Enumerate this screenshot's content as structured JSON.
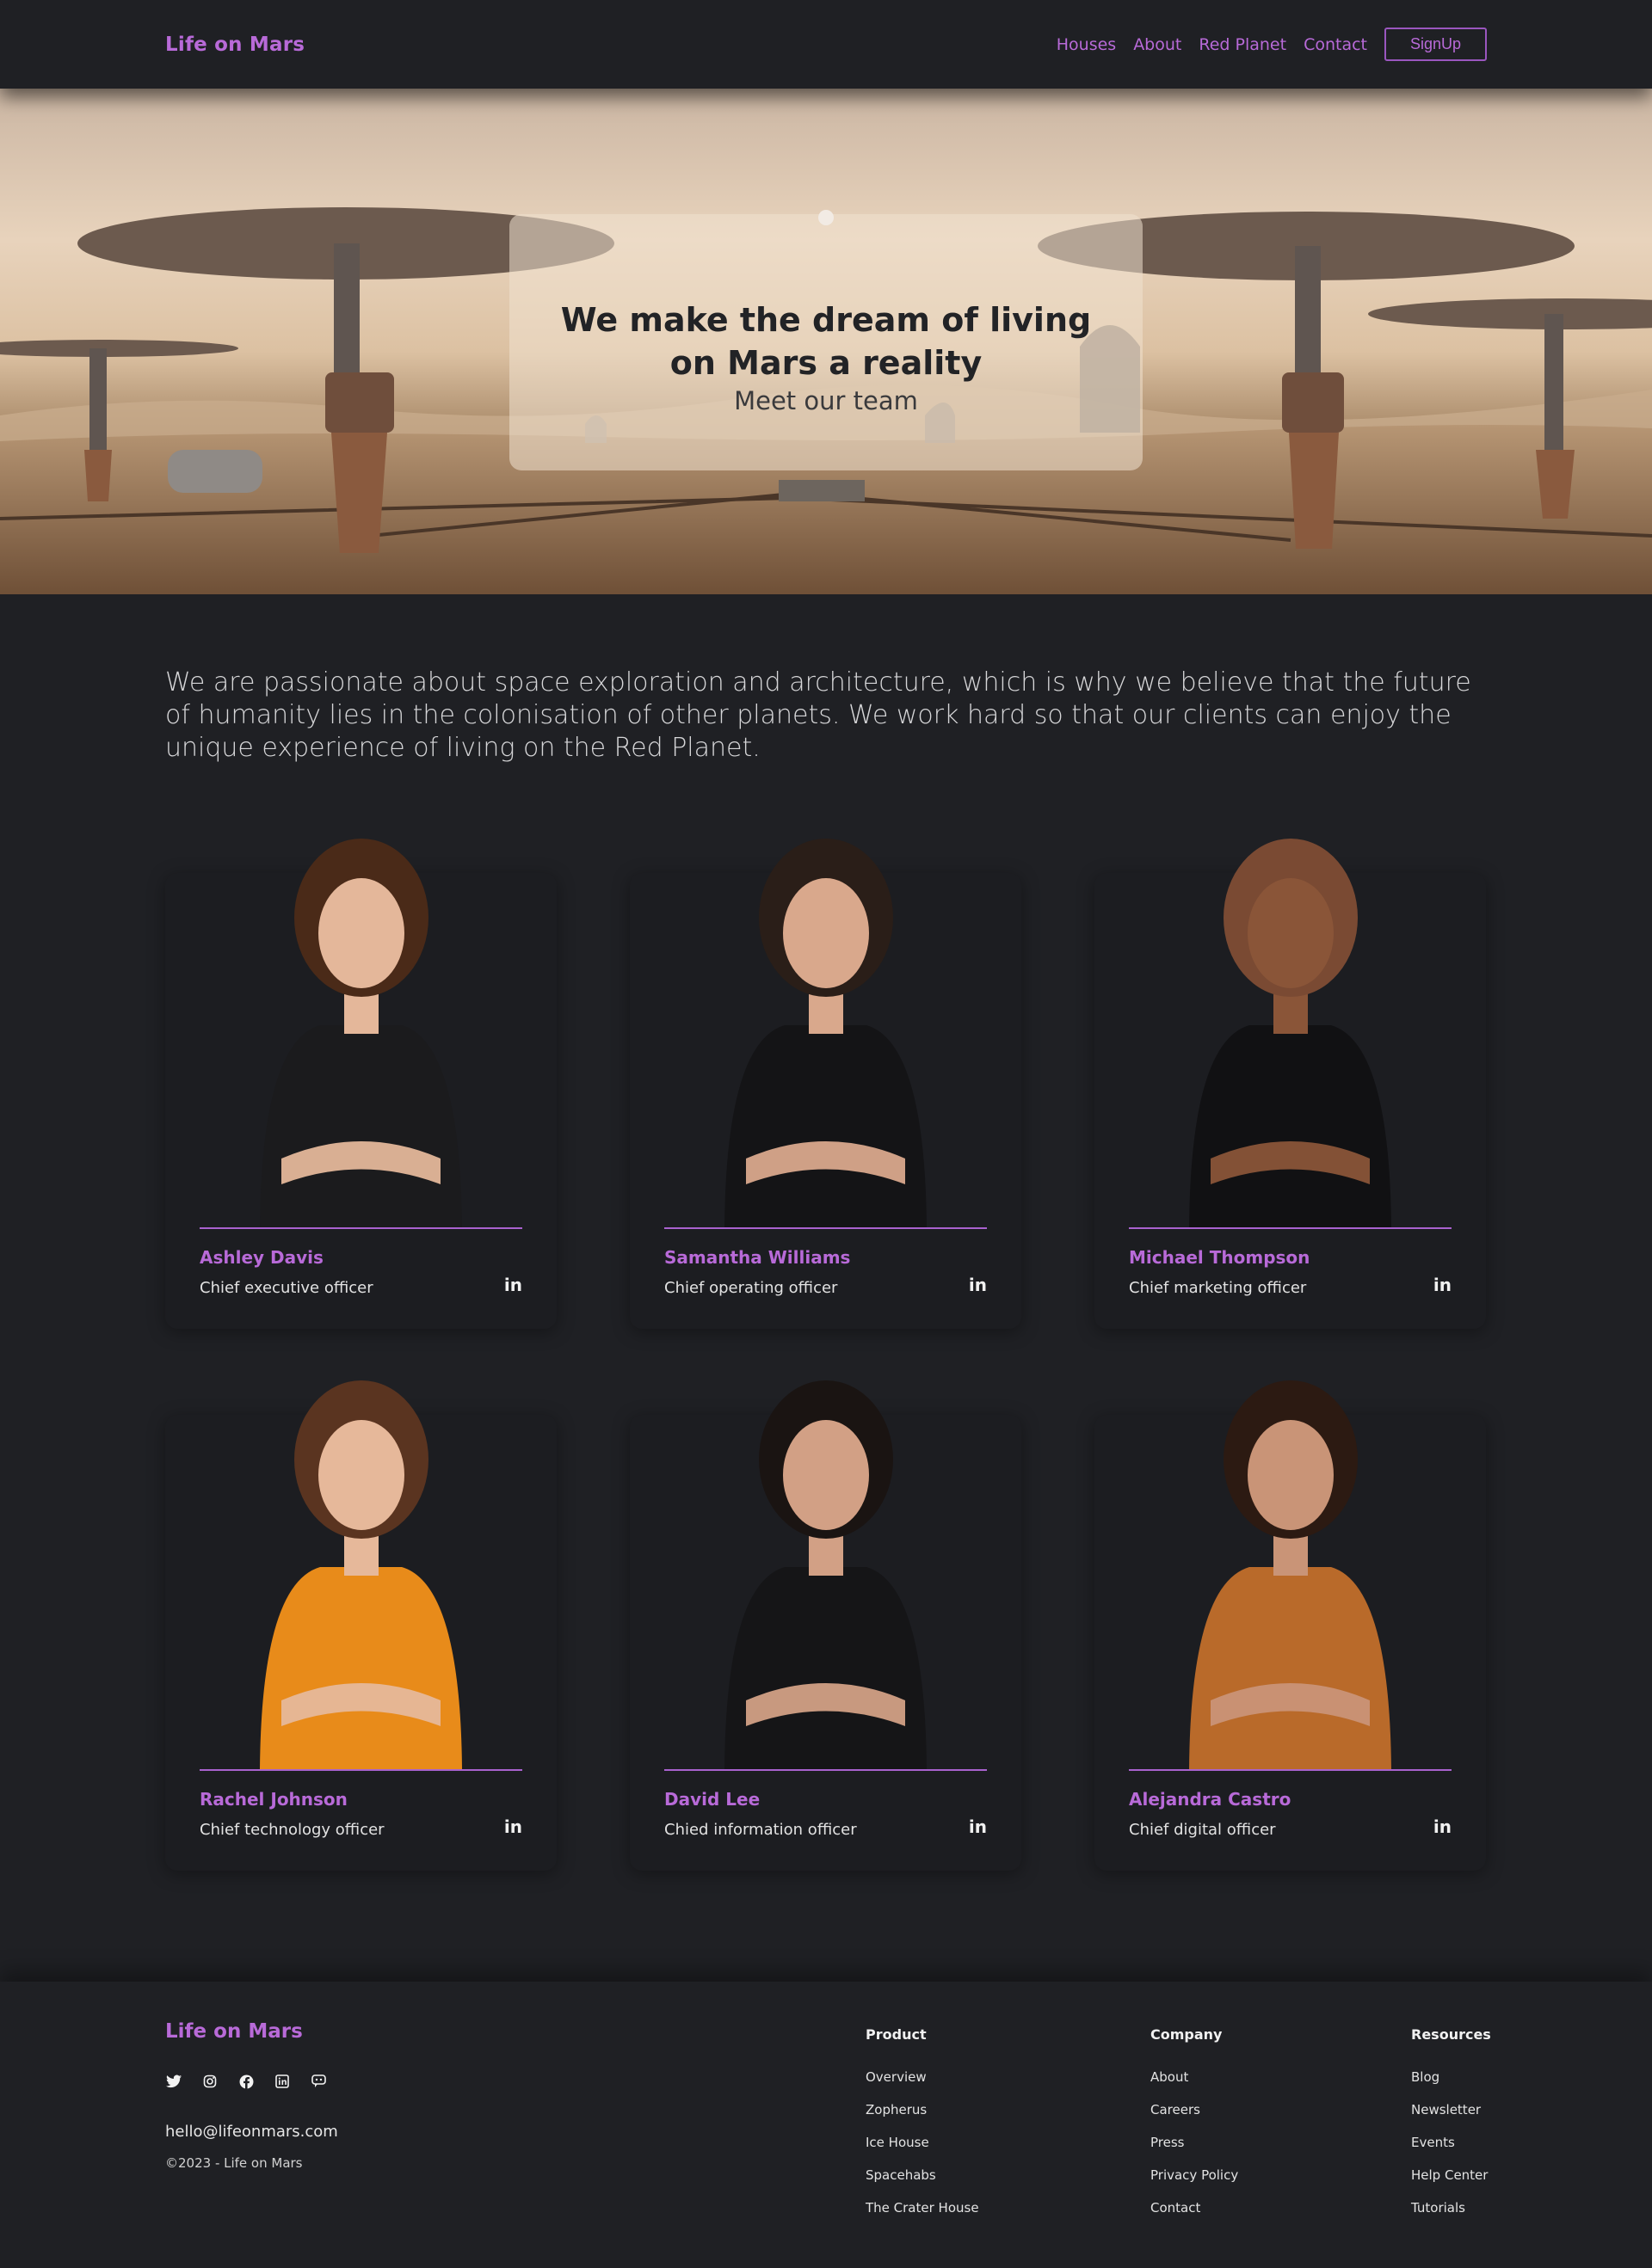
{
  "nav": {
    "brand": "Life on Mars",
    "links": [
      "Houses",
      "About",
      "Red Planet",
      "Contact"
    ],
    "signup": "SignUp"
  },
  "hero": {
    "title": "We make the dream of living on Mars a reality",
    "subtitle": "Meet our team"
  },
  "intro": "We are passionate about space exploration and architecture, which is why we believe that the future of humanity lies in the colonisation of other planets. We work hard so that our clients can enjoy the unique experience of living on the Red Planet.",
  "team": [
    {
      "name": "Ashley Davis",
      "role": "Chief executive officer",
      "icon": "linkedin-icon",
      "linkedin": "in",
      "top_color": "#1b1b1d",
      "hair": "#4a2a18",
      "skin": "#e4b79a"
    },
    {
      "name": "Samantha Williams",
      "role": "Chief operating officer",
      "icon": "linkedin-icon",
      "linkedin": "in",
      "top_color": "#141416",
      "hair": "#2a1e18",
      "skin": "#d9a88c"
    },
    {
      "name": "Michael Thompson",
      "role": "Chief marketing officer",
      "icon": "linkedin-icon",
      "linkedin": "in",
      "top_color": "#111113",
      "hair": "#7a4a33",
      "skin": "#8a5538"
    },
    {
      "name": "Rachel Johnson",
      "role": "Chief technology officer",
      "icon": "linkedin-icon",
      "linkedin": "in",
      "top_color": "#e88b1a",
      "hair": "#5a3420",
      "skin": "#e6b89a"
    },
    {
      "name": "David Lee",
      "role": "Chied information officer",
      "icon": "linkedin-icon",
      "linkedin": "in",
      "top_color": "#151517",
      "hair": "#1a1412",
      "skin": "#d2a085"
    },
    {
      "name": "Alejandra Castro",
      "role": "Chief digital officer",
      "icon": "linkedin-icon",
      "linkedin": "in",
      "top_color": "#b96a2a",
      "hair": "#2c1a12",
      "skin": "#c99477"
    }
  ],
  "footer": {
    "brand": "Life on Mars",
    "social_icons": [
      "twitter-icon",
      "instagram-icon",
      "facebook-icon",
      "linkedin-icon",
      "discord-icon"
    ],
    "email": "hello@lifeonmars.com",
    "copyright": "©2023 - Life on Mars",
    "columns": [
      {
        "title": "Product",
        "links": [
          "Overview",
          "Zopherus",
          "Ice House",
          "Spacehabs",
          "The Crater House"
        ]
      },
      {
        "title": "Company",
        "links": [
          "About",
          "Careers",
          "Press",
          "Privacy Policy",
          "Contact"
        ]
      },
      {
        "title": "Resources",
        "links": [
          "Blog",
          "Newsletter",
          "Events",
          "Help Center",
          "Tutorials"
        ]
      }
    ]
  },
  "colors": {
    "accent": "#b86ad8",
    "background": "#1f2024",
    "card": "#1c1d21"
  }
}
